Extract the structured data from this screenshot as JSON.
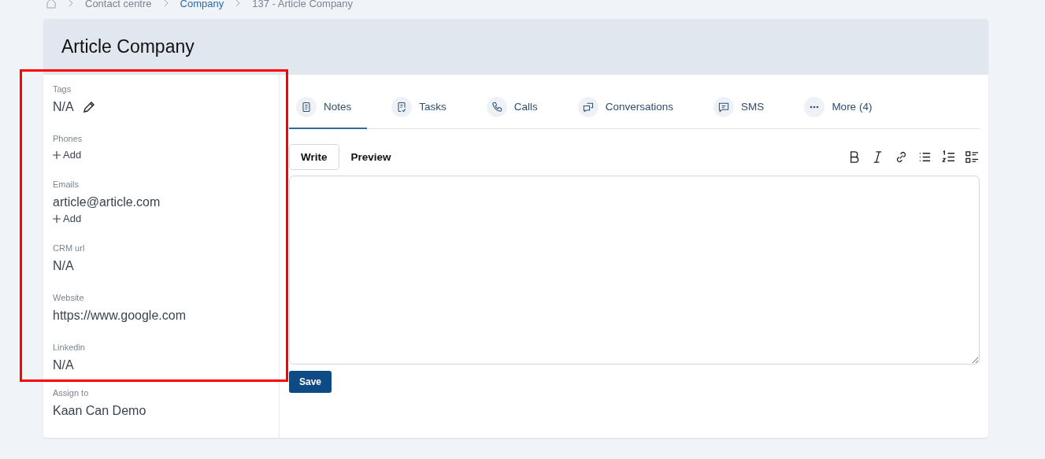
{
  "breadcrumb": [
    {
      "label": "Contact centre",
      "link": false
    },
    {
      "label": "Company",
      "link": true
    },
    {
      "label": "137 - Article Company",
      "link": false
    }
  ],
  "title": "Article Company",
  "fields": [
    {
      "label": "Tags",
      "values": [
        "N/A"
      ],
      "editable": true
    },
    {
      "label": "Phones",
      "add": "Add"
    },
    {
      "label": "Emails",
      "values": [
        "article@article.com"
      ],
      "add": "Add"
    },
    {
      "label": "CRM url",
      "values": [
        "N/A"
      ]
    },
    {
      "label": "Website",
      "values": [
        "https://www.google.com"
      ]
    },
    {
      "label": "Linkedin",
      "values": [
        "N/A"
      ]
    },
    {
      "label": "Assign to",
      "values": [
        "Kaan Can Demo"
      ]
    }
  ],
  "highlight_box": true,
  "tabs": [
    {
      "label": "Notes",
      "selected": true
    },
    {
      "label": "Tasks",
      "selected": false
    },
    {
      "label": "Calls",
      "selected": false
    },
    {
      "label": "Conversations",
      "selected": false
    },
    {
      "label": "SMS",
      "selected": false
    },
    {
      "label": "More (4)",
      "selected": false
    }
  ],
  "editor_modes": [
    {
      "label": "Write",
      "selected": true
    },
    {
      "label": "Preview",
      "selected": false
    }
  ],
  "save_button": "Save"
}
